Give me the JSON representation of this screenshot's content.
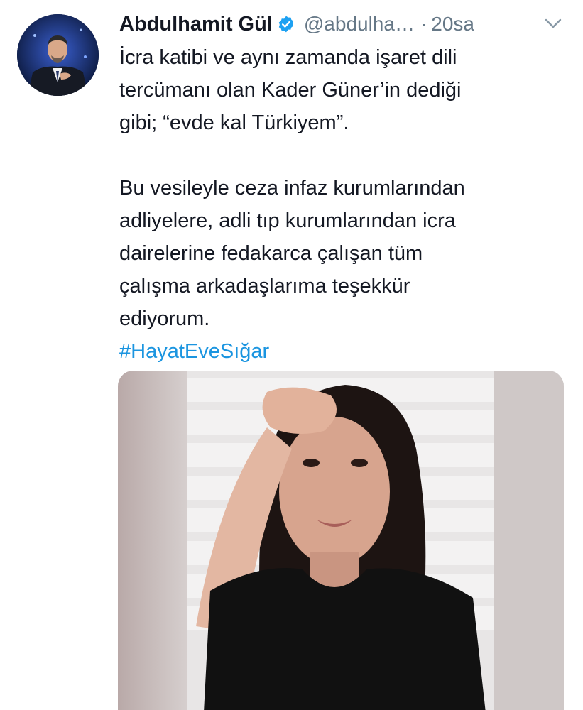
{
  "tweet": {
    "author_name": "Abdulhamit Gül",
    "handle": "@abdulha…",
    "separator": "·",
    "timestamp": "20sa",
    "text_lines_1": [
      "İcra katibi ve aynı zamanda işaret dili",
      "tercümanı olan Kader Güner’in dediği",
      "gibi; “evde kal Türkiyem”."
    ],
    "text_lines_2": [
      "Bu vesileyle ceza infaz kurumlarından",
      "adliyelere, adli tıp kurumlarından icra",
      "dairelerine fedakarca çalışan tüm",
      "çalışma arkadaşlarıma teşekkür",
      "ediyorum."
    ],
    "hashtag": "#HayatEveSığar"
  },
  "icons": {
    "verified": "verified-badge-icon",
    "menu": "chevron-down-icon"
  },
  "colors": {
    "accent": "#1b95e0",
    "muted": "#657786",
    "text": "#141823"
  }
}
